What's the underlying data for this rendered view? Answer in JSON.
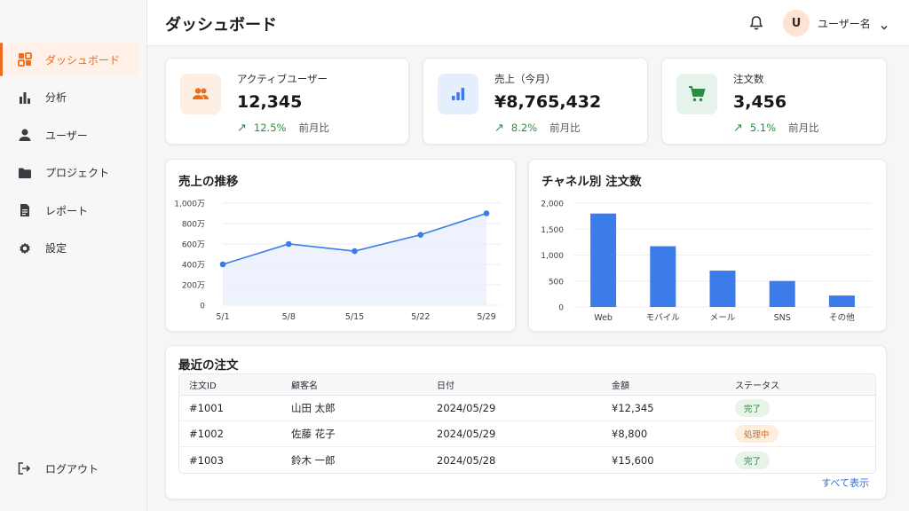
{
  "sidebar": {
    "items": [
      {
        "label": "ダッシュボード",
        "icon": "dashboard-icon",
        "active": true
      },
      {
        "label": "分析",
        "icon": "bar-chart-icon"
      },
      {
        "label": "ユーザー",
        "icon": "user-icon"
      },
      {
        "label": "プロジェクト",
        "icon": "folder-icon"
      },
      {
        "label": "レポート",
        "icon": "document-icon"
      },
      {
        "label": "設定",
        "icon": "gear-icon"
      }
    ],
    "logout_label": "ログアウト"
  },
  "header": {
    "title": "ダッシュボード",
    "avatar_initial": "U",
    "user_name": "ユーザー名"
  },
  "stats": [
    {
      "label": "アクティブユーザー",
      "value": "12,345",
      "delta": "12.5%",
      "compare": "前月比",
      "icon": "users-icon",
      "icon_bg": "#fdeee4",
      "icon_color": "#ef6c1a"
    },
    {
      "label": "売上（今月）",
      "value": "¥8,765,432",
      "delta": "8.2%",
      "compare": "前月比",
      "icon": "bar-chart-icon",
      "icon_bg": "#e5eefc",
      "icon_color": "#3b7bea"
    },
    {
      "label": "注文数",
      "value": "3,456",
      "delta": "5.1%",
      "compare": "前月比",
      "icon": "cart-icon",
      "icon_bg": "#e6f3ea",
      "icon_color": "#2e8b45"
    }
  ],
  "sales_chart": {
    "title": "売上の推移",
    "chart_data": {
      "type": "area",
      "x": [
        "5/1",
        "5/8",
        "5/15",
        "5/22",
        "5/29"
      ],
      "values": [
        400,
        600,
        530,
        690,
        900
      ],
      "unit": "万",
      "ylim": [
        0,
        1000
      ],
      "yticks": [
        "0",
        "200万",
        "400万",
        "600万",
        "800万",
        "1,000万"
      ],
      "color": "#3b7bea"
    }
  },
  "channel_chart": {
    "title": "チャネル別 注文数",
    "chart_data": {
      "type": "bar",
      "categories": [
        "Web",
        "モバイル",
        "メール",
        "SNS",
        "その他"
      ],
      "values": [
        1800,
        1170,
        700,
        500,
        220
      ],
      "ylim": [
        0,
        2000
      ],
      "yticks": [
        "0",
        "500",
        "1,000",
        "1,500",
        "2,000"
      ],
      "color": "#3b7bea"
    }
  },
  "orders": {
    "title": "最近の注文",
    "columns": [
      "注文ID",
      "顧客名",
      "日付",
      "金額",
      "ステータス"
    ],
    "rows": [
      {
        "id": "#1001",
        "customer": "山田 太郎",
        "date": "2024/05/29",
        "amount": "¥12,345",
        "status": "完了",
        "status_type": "done"
      },
      {
        "id": "#1002",
        "customer": "佐藤 花子",
        "date": "2024/05/29",
        "amount": "¥8,800",
        "status": "処理中",
        "status_type": "proc"
      },
      {
        "id": "#1003",
        "customer": "鈴木 一郎",
        "date": "2024/05/28",
        "amount": "¥15,600",
        "status": "完了",
        "status_type": "done"
      }
    ],
    "view_all": "すべて表示"
  }
}
